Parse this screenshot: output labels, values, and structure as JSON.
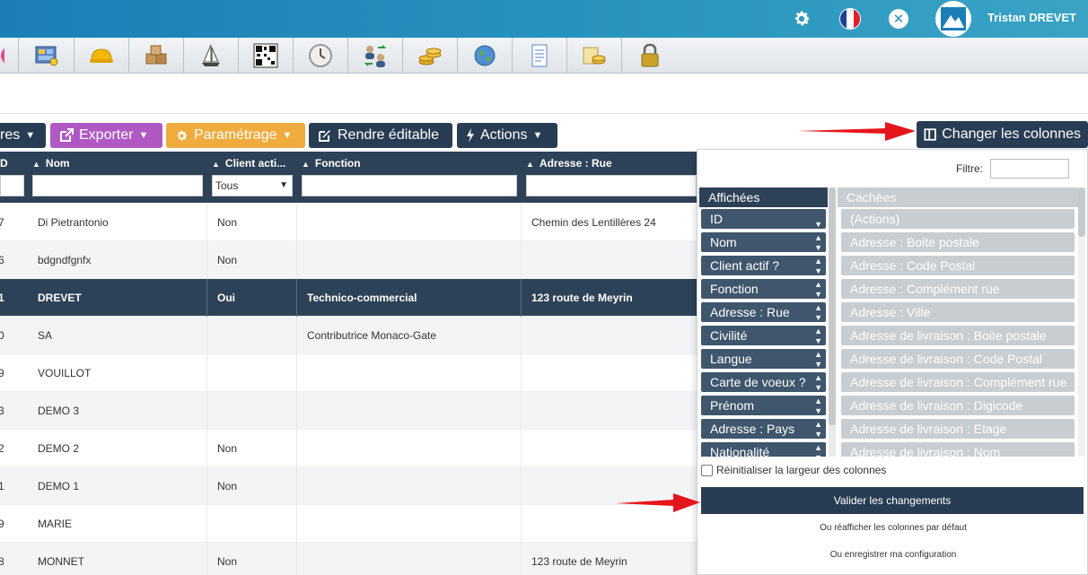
{
  "header": {
    "username": "Tristan DREVET",
    "icons": [
      "gear-icon",
      "france-flag-icon",
      "close-icon",
      "avatar-logo-icon"
    ]
  },
  "modules": [
    "pie-chart-icon",
    "dashboard-icon",
    "hard-hat-icon",
    "boxes-icon",
    "sailboat-icon",
    "qr-code-icon",
    "clock-icon",
    "users-exchange-icon",
    "coins-icon",
    "globe-icon",
    "document-icon",
    "folder-coins-icon",
    "lock-icon"
  ],
  "actions": {
    "filtres_label": "res",
    "exporter_label": "Exporter",
    "parametrage_label": "Paramétrage",
    "rendre_editable_label": "Rendre éditable",
    "actions_label": "Actions",
    "changer_colonnes_label": "Changer les colonnes"
  },
  "table": {
    "columns": [
      "D",
      "Nom",
      "Client acti...",
      "Fonction",
      "Adresse : Rue"
    ],
    "client_filter_value": "Tous",
    "rows": [
      {
        "id": "7",
        "nom": "Di Pietrantonio",
        "client": "Non",
        "fonction": "",
        "rue": "Chemin des Lentillères 24"
      },
      {
        "id": "6",
        "nom": "bdgndfgnfx",
        "client": "Non",
        "fonction": "",
        "rue": ""
      },
      {
        "id": "1",
        "nom": "DREVET",
        "client": "Oui",
        "fonction": "Technico-commercial",
        "rue": "123 route de Meyrin"
      },
      {
        "id": "0",
        "nom": "SA",
        "client": "",
        "fonction": "Contributrice Monaco-Gate",
        "rue": ""
      },
      {
        "id": "9",
        "nom": "VOUILLOT",
        "client": "",
        "fonction": "",
        "rue": ""
      },
      {
        "id": "3",
        "nom": "DEMO 3",
        "client": "",
        "fonction": "",
        "rue": ""
      },
      {
        "id": "2",
        "nom": "DEMO 2",
        "client": "Non",
        "fonction": "",
        "rue": ""
      },
      {
        "id": "1",
        "nom": "DEMO 1",
        "client": "Non",
        "fonction": "",
        "rue": ""
      },
      {
        "id": "9",
        "nom": "MARIE",
        "client": "",
        "fonction": "",
        "rue": ""
      },
      {
        "id": "8",
        "nom": "MONNET",
        "client": "Non",
        "fonction": "",
        "rue": "123 route de Meyrin"
      }
    ]
  },
  "panel": {
    "filtre_label": "Filtre:",
    "affichees_label": "Affichées",
    "cachees_label": "Cachées",
    "affichees": [
      "ID",
      "Nom",
      "Client actif ?",
      "Fonction",
      "Adresse : Rue",
      "Civilité",
      "Langue",
      "Carte de voeux ?",
      "Prénom",
      "Adresse : Pays",
      "Nationalité"
    ],
    "cachees": [
      "(Actions)",
      "Adresse : Boite postale",
      "Adresse : Code Postal",
      "Adresse : Complément rue",
      "Adresse : Ville",
      "Adresse de livraison : Boite postale",
      "Adresse de livraison : Code Postal",
      "Adresse de livraison : Complément rue",
      "Adresse de livraison : Digicode",
      "Adresse de livraison : Etage",
      "Adresse de livraison : Nom"
    ],
    "reset_label": "Réinitialiser la largeur des colonnes",
    "validate_label": "Valider les changements",
    "default_label": "Ou réafficher les colonnes par défaut",
    "save_label": "Ou enregistrer ma configuration"
  },
  "colors": {
    "header_blue": "#1b7fb6",
    "dark_navy": "#283d54",
    "purple": "#b059c5",
    "orange": "#efab3d",
    "arrow_red": "#e5161b"
  }
}
